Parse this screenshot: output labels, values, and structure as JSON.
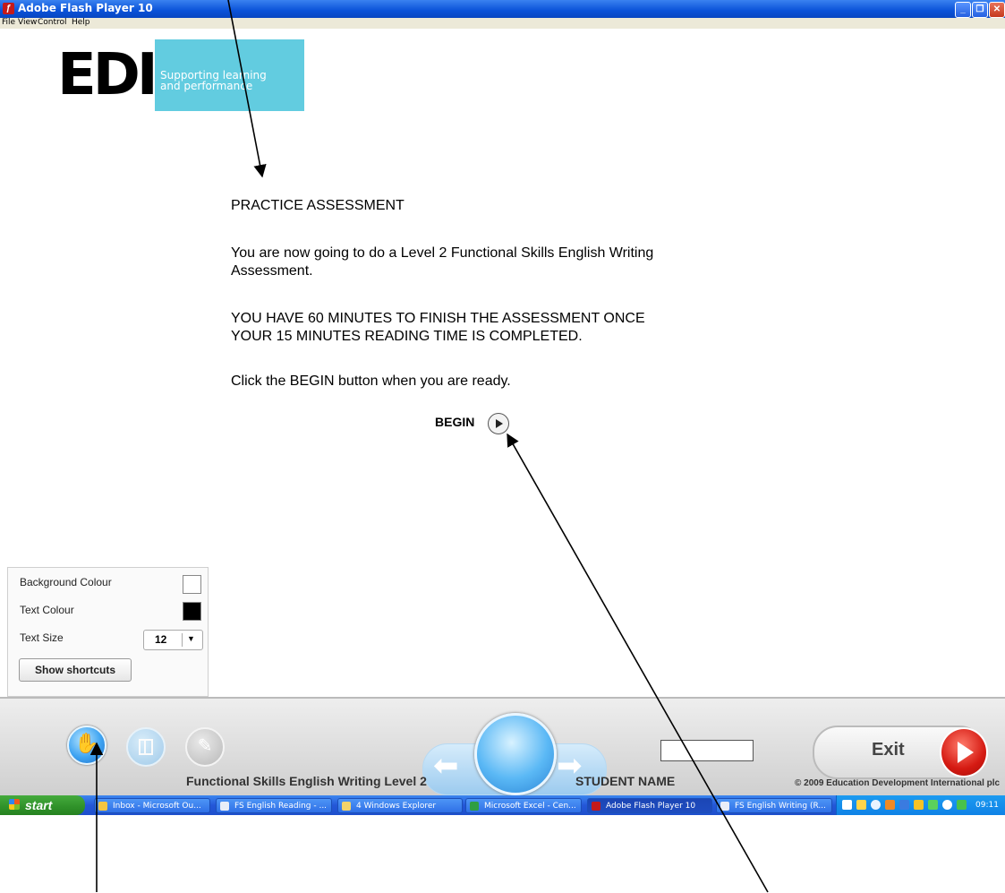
{
  "window": {
    "title": "Adobe Flash Player 10"
  },
  "menu": [
    "File",
    "View",
    "Control",
    "Help"
  ],
  "logo": {
    "brand": "EDI",
    "tagline": "Supporting learning\nand performance"
  },
  "content": {
    "heading": "PRACTICE ASSESSMENT",
    "intro_line1": "You are now going to do a Level 2 Functional Skills English Writing",
    "intro_line2": "Assessment.",
    "warning_line1": "YOU HAVE 60 MINUTES TO FINISH THE ASSESSMENT ONCE",
    "warning_line2": "YOUR 15 MINUTES READING TIME IS COMPLETED.",
    "instruction": "Click the BEGIN button when you are ready.",
    "begin_label": "BEGIN"
  },
  "settings": {
    "background_label": "Background Colour",
    "background_value": "#ffffff",
    "text_colour_label": "Text Colour",
    "text_colour_value": "#000000",
    "text_size_label": "Text Size",
    "text_size_value": "12",
    "shortcuts_label": "Show shortcuts"
  },
  "toolbar": {
    "course_title": "Functional Skills English Writing Level 2",
    "student_label": "STUDENT NAME",
    "student_name_value": "",
    "exit_label": "Exit",
    "copyright": "© 2009 Education Development International plc",
    "icons": [
      "hand-icon",
      "layout-icon",
      "pencil-icon",
      "back-arrow-icon",
      "forward-arrow-icon"
    ]
  },
  "taskbar": {
    "start_label": "start",
    "tasks": [
      "Inbox - Microsoft Ou...",
      "FS English Reading - ...",
      "4 Windows Explorer",
      "Microsoft Excel - Cen...",
      "Adobe Flash Player 10",
      "FS English Writing (R..."
    ],
    "active_task": "Adobe Flash Player 10",
    "clock": "09:11"
  }
}
